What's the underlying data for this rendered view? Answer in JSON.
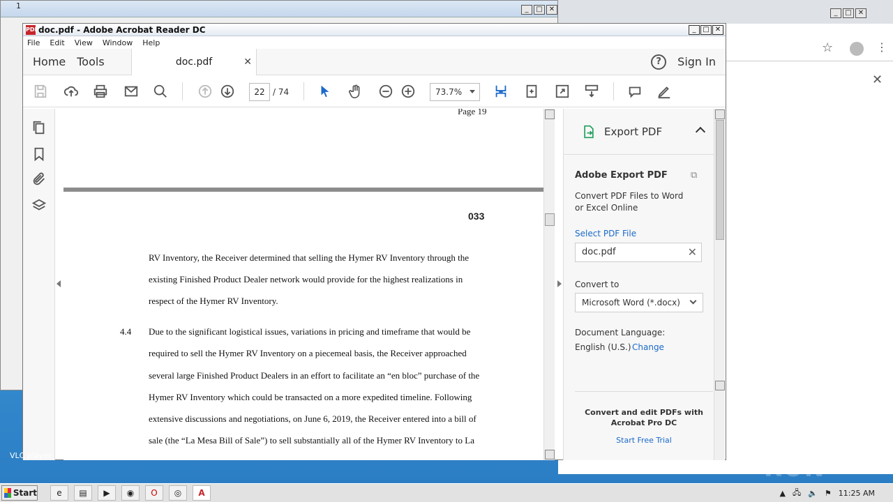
{
  "background": {
    "explorer_title": "1",
    "vlc_label": "VLC player",
    "watermark": "ANY RUN"
  },
  "window": {
    "title": "doc.pdf - Adobe Acrobat Reader DC",
    "menu": [
      "File",
      "Edit",
      "View",
      "Window",
      "Help"
    ]
  },
  "nav": {
    "home": "Home",
    "tools": "Tools",
    "tab_label": "doc.pdf",
    "sign_in": "Sign In"
  },
  "toolbar": {
    "current_page": "22",
    "total_pages": "/ 74",
    "zoom": "73.7%"
  },
  "document": {
    "page_header": "Page 19",
    "page_number": "033",
    "paragraph_continued": [
      "RV Inventory, the Receiver determined that selling the Hymer RV Inventory through the",
      "existing Finished Product Dealer network would provide for the highest realizations in",
      "respect of the Hymer RV Inventory."
    ],
    "section_number": "4.4",
    "section_lines": [
      "Due to the significant logistical issues, variations in pricing and timeframe that would be",
      "required to sell the Hymer RV Inventory on a piecemeal basis, the Receiver approached",
      "several large Finished Product Dealers in an effort to facilitate an “en bloc” purchase of the",
      "Hymer RV Inventory which could be transacted on a more expedited timeline. Following",
      "extensive discussions and negotiations, on June 6, 2019, the Receiver entered into a bill of",
      "sale (the “La Mesa Bill of Sale”) to sell substantially all of the Hymer RV Inventory to La"
    ]
  },
  "export_pane": {
    "header": "Export PDF",
    "title": "Adobe Export PDF",
    "description": "Convert PDF Files to Word or Excel Online",
    "select_label": "Select PDF File",
    "file_name": "doc.pdf",
    "convert_label": "Convert to",
    "convert_value": "Microsoft Word (*.docx)",
    "language_label": "Document Language:",
    "language_value": "English (U.S.)",
    "change_link": "Change",
    "promo": "Convert and edit PDFs with Acrobat Pro DC",
    "trial_link": "Start Free Trial"
  },
  "taskbar": {
    "start": "Start",
    "time": "11:25 AM"
  },
  "colors": {
    "accent_blue": "#1b6ac9",
    "pdf_red": "#c7252c",
    "desktop_blue": "#2a7cc2"
  }
}
